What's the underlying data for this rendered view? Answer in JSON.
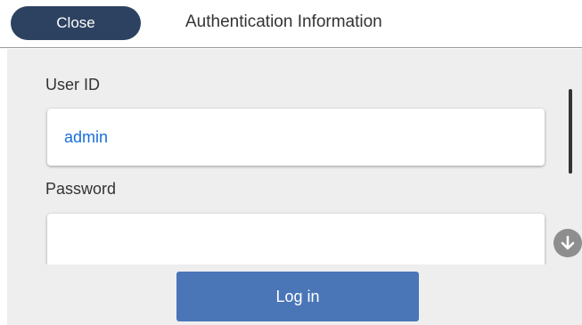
{
  "header": {
    "close_label": "Close",
    "title": "Authentication Information"
  },
  "form": {
    "user_id_label": "User ID",
    "user_id_value": "admin",
    "password_label": "Password",
    "password_value": ""
  },
  "footer": {
    "login_label": "Log in"
  },
  "icons": {
    "scroll_down": "arrow-down-circle-icon"
  },
  "colors": {
    "close_button": "#2c4260",
    "login_button": "#4a76b8",
    "input_text": "#1a6ed8",
    "content_background": "#eeeeee"
  }
}
